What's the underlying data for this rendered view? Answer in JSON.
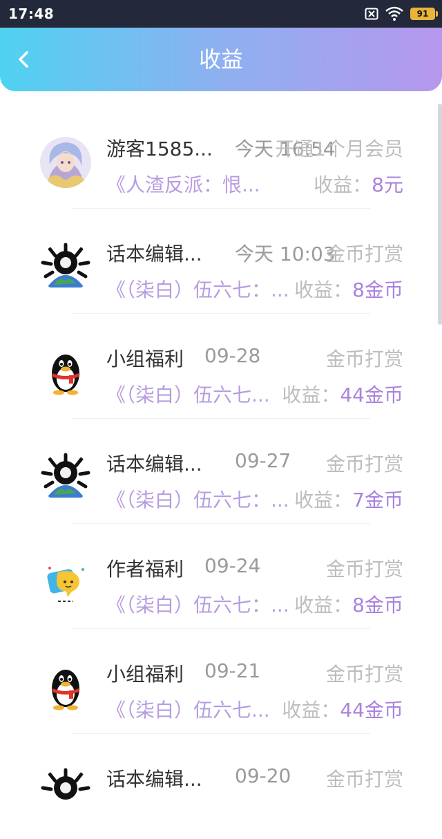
{
  "status_bar": {
    "time": "17:48",
    "battery": "91",
    "icons": [
      "sim-off-icon",
      "wifi-icon",
      "battery-icon"
    ]
  },
  "header": {
    "title": "收益",
    "back_icon": "chevron-left-icon",
    "gradient": [
      "#4fd2f1",
      "#b597ee"
    ]
  },
  "colors": {
    "book_title": "#b69ce0",
    "earnings_value": "#a983dc",
    "muted": "#bdbdbd"
  },
  "items": [
    {
      "avatar": "anime-girl-avatar",
      "name": "游客1585...",
      "date": "今天 16:54",
      "type": "开通1个月会员",
      "book": "《人渣反派：恨...",
      "earn_label": "收益：",
      "earn_value": "8元"
    },
    {
      "avatar": "skull-globe-avatar",
      "name": "话本编辑...",
      "date": "今天 10:03",
      "type": "金币打赏",
      "book": "《（柒白）伍六七：...",
      "earn_label": "收益：",
      "earn_value": "8金币"
    },
    {
      "avatar": "qq-penguin-avatar",
      "name": "小组福利",
      "date": "09-28",
      "type": "金币打赏",
      "book": "《（柒白）伍六七...",
      "earn_label": "收益：",
      "earn_value": "44金币"
    },
    {
      "avatar": "skull-globe-avatar",
      "name": "话本编辑...",
      "date": "09-27",
      "type": "金币打赏",
      "book": "《（柒白）伍六七：...",
      "earn_label": "收益：",
      "earn_value": "7金币"
    },
    {
      "avatar": "chat-bubble-avatar",
      "name": "作者福利",
      "date": "09-24",
      "type": "金币打赏",
      "book": "《（柒白）伍六七：...",
      "earn_label": "收益：",
      "earn_value": "8金币"
    },
    {
      "avatar": "qq-penguin-avatar",
      "name": "小组福利",
      "date": "09-21",
      "type": "金币打赏",
      "book": "《（柒白）伍六七...",
      "earn_label": "收益：",
      "earn_value": "44金币"
    },
    {
      "avatar": "skull-globe-avatar",
      "name": "话本编辑...",
      "date": "09-20",
      "type": "金币打赏",
      "book": "",
      "earn_label": "",
      "earn_value": ""
    }
  ]
}
